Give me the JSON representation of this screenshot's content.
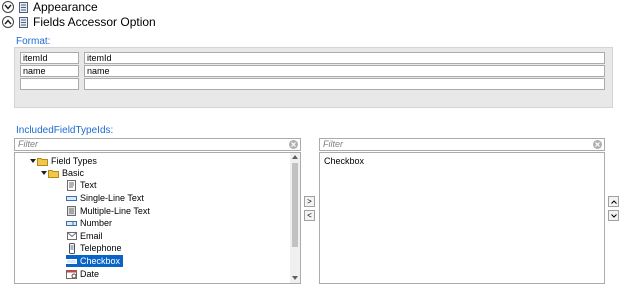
{
  "sections": [
    {
      "title": "Appearance",
      "expanded": false,
      "toggle_icon": "chevron-down-icon",
      "icon": "property-sheet-icon"
    },
    {
      "title": "Fields Accessor Option",
      "expanded": true,
      "toggle_icon": "chevron-up-icon",
      "icon": "property-sheet-icon"
    }
  ],
  "format": {
    "label": "Format:",
    "rows": [
      {
        "key": "itemId",
        "value": "itemId"
      },
      {
        "key": "name",
        "value": "name"
      },
      {
        "key": "",
        "value": ""
      }
    ]
  },
  "included_field_type_ids": {
    "label": "IncludedFieldTypeIds:",
    "available": {
      "filter_placeholder": "Filter",
      "tree": [
        {
          "label": "Field Types",
          "icon": "folder-icon",
          "expanded": true,
          "level": 0
        },
        {
          "label": "Basic",
          "icon": "folder-icon",
          "expanded": true,
          "level": 1
        },
        {
          "label": "Text",
          "icon": "text-field-icon",
          "level": 2
        },
        {
          "label": "Single-Line Text",
          "icon": "single-line-text-icon",
          "level": 2
        },
        {
          "label": "Multiple-Line Text",
          "icon": "multi-line-text-icon",
          "level": 2
        },
        {
          "label": "Number",
          "icon": "number-icon",
          "level": 2
        },
        {
          "label": "Email",
          "icon": "email-icon",
          "level": 2
        },
        {
          "label": "Telephone",
          "icon": "telephone-icon",
          "level": 2
        },
        {
          "label": "Checkbox",
          "icon": "checkbox-icon",
          "level": 2,
          "selected": true
        },
        {
          "label": "Date",
          "icon": "date-icon",
          "level": 2
        }
      ]
    },
    "add_button": ">",
    "remove_button": "<",
    "selected": {
      "filter_placeholder": "Filter",
      "items": [
        "Checkbox"
      ]
    },
    "move_up_button": "^",
    "move_down_button": "v"
  },
  "colors": {
    "label_blue": "#1f6bd1",
    "selection": "#0a64c8",
    "group_background": "#e8e8e8"
  }
}
